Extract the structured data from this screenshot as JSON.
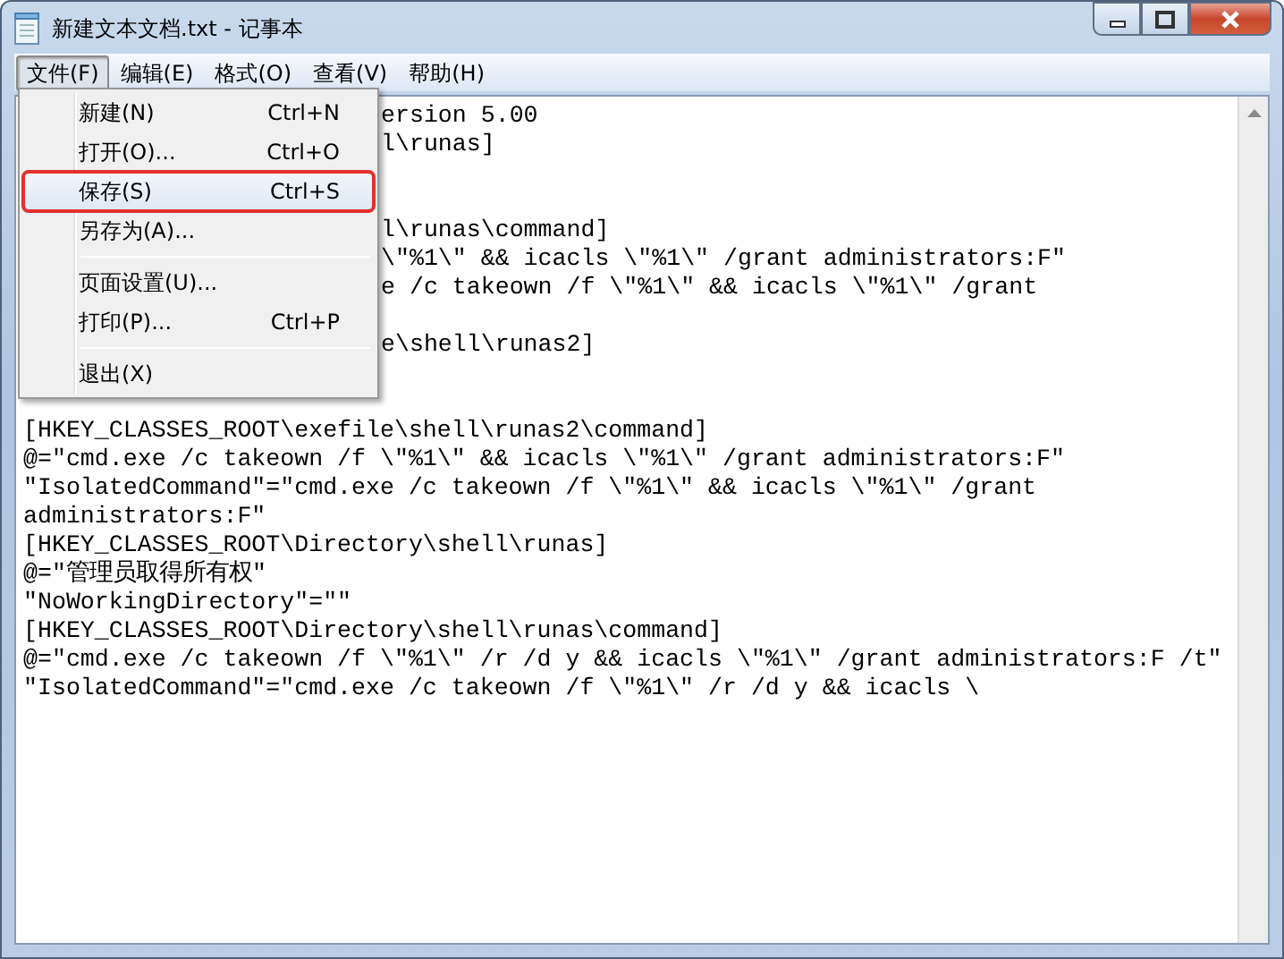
{
  "window": {
    "title": "新建文本文档.txt - 记事本"
  },
  "menu_bar": [
    {
      "label": "文件(F)",
      "selected": true
    },
    {
      "label": "编辑(E)",
      "selected": false
    },
    {
      "label": "格式(O)",
      "selected": false
    },
    {
      "label": "查看(V)",
      "selected": false
    },
    {
      "label": "帮助(H)",
      "selected": false
    }
  ],
  "file_menu": {
    "items": [
      {
        "kind": "item",
        "label": "新建(N)",
        "shortcut": "Ctrl+N",
        "selected": false,
        "outlined": false
      },
      {
        "kind": "item",
        "label": "打开(O)...",
        "shortcut": "Ctrl+O",
        "selected": false,
        "outlined": false
      },
      {
        "kind": "item",
        "label": "保存(S)",
        "shortcut": "Ctrl+S",
        "selected": true,
        "outlined": true
      },
      {
        "kind": "item",
        "label": "另存为(A)...",
        "selected": false,
        "outlined": false
      },
      {
        "kind": "separator"
      },
      {
        "kind": "item",
        "label": "页面设置(U)...",
        "selected": false,
        "outlined": false
      },
      {
        "kind": "item",
        "label": "打印(P)...",
        "shortcut": "Ctrl+P",
        "selected": false,
        "outlined": false
      },
      {
        "kind": "separator"
      },
      {
        "kind": "item",
        "label": "退出(X)",
        "selected": false,
        "outlined": false
      }
    ]
  },
  "editor": {
    "lines": [
      {
        "kind": "partial",
        "text": "ersion 5.00"
      },
      {
        "kind": "partial",
        "text": "l\\runas]"
      },
      {
        "kind": "blank"
      },
      {
        "kind": "blank"
      },
      {
        "kind": "partial",
        "text": "l\\runas\\command]"
      },
      {
        "kind": "partial",
        "text": "\\\"%1\\\" && icacls \\\"%1\\\" /grant administrators:F\""
      },
      {
        "kind": "partial",
        "text": "e /c takeown /f \\\"%1\\\" && icacls \\\"%1\\\" /grant"
      },
      {
        "kind": "blank"
      },
      {
        "kind": "partial",
        "text": "e\\shell\\runas2]"
      },
      {
        "kind": "blank"
      },
      {
        "kind": "blank"
      },
      {
        "kind": "full",
        "text": "[HKEY_CLASSES_ROOT\\exefile\\shell\\runas2\\command]"
      },
      {
        "kind": "full",
        "text": "@=\"cmd.exe /c takeown /f \\\"%1\\\" && icacls \\\"%1\\\" /grant administrators:F\""
      },
      {
        "kind": "full",
        "text": "\"IsolatedCommand\"=\"cmd.exe /c takeown /f \\\"%1\\\" && icacls \\\"%1\\\" /grant"
      },
      {
        "kind": "full",
        "text": "administrators:F\""
      },
      {
        "kind": "full",
        "text": "[HKEY_CLASSES_ROOT\\Directory\\shell\\runas]"
      },
      {
        "kind": "full",
        "text": "@=\"管理员取得所有权\""
      },
      {
        "kind": "full",
        "text": "\"NoWorkingDirectory\"=\"\""
      },
      {
        "kind": "full",
        "text": "[HKEY_CLASSES_ROOT\\Directory\\shell\\runas\\command]"
      },
      {
        "kind": "full",
        "text": "@=\"cmd.exe /c takeown /f \\\"%1\\\" /r /d y && icacls \\\"%1\\\" /grant administrators:F /t\""
      },
      {
        "kind": "full",
        "text": "\"IsolatedCommand\"=\"cmd.exe /c takeown /f \\\"%1\\\" /r /d y && icacls \\"
      }
    ]
  }
}
